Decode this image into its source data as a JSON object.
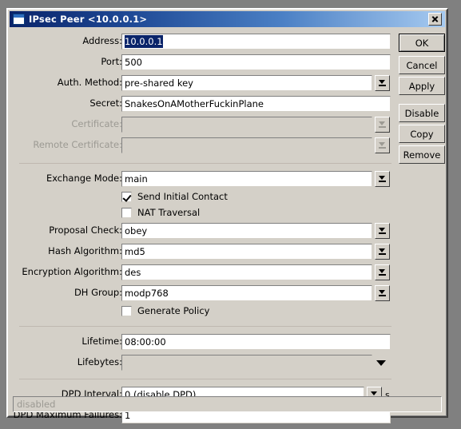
{
  "window": {
    "title": "IPsec Peer <10.0.0.1>",
    "icon": "window-icon",
    "close_icon": "close-icon"
  },
  "fields": {
    "address": {
      "label": "Address:",
      "value": "10.0.0.1",
      "selected": true
    },
    "port": {
      "label": "Port:",
      "value": "500"
    },
    "auth_method": {
      "label": "Auth. Method:",
      "value": "pre-shared key"
    },
    "secret": {
      "label": "Secret:",
      "value": "SnakesOnAMotherFuckinPlane"
    },
    "certificate": {
      "label": "Certificate:",
      "value": "",
      "disabled": true
    },
    "remote_certificate": {
      "label": "Remote Certificate:",
      "value": "",
      "disabled": true
    },
    "exchange_mode": {
      "label": "Exchange Mode:",
      "value": "main"
    },
    "proposal_check": {
      "label": "Proposal Check:",
      "value": "obey"
    },
    "hash_algorithm": {
      "label": "Hash Algorithm:",
      "value": "md5"
    },
    "encryption_algorithm": {
      "label": "Encryption Algorithm:",
      "value": "des"
    },
    "dh_group": {
      "label": "DH Group:",
      "value": "modp768"
    },
    "lifetime": {
      "label": "Lifetime:",
      "value": "08:00:00"
    },
    "lifebytes": {
      "label": "Lifebytes:",
      "value": "",
      "disabled": true
    },
    "dpd_interval": {
      "label": "DPD Interval:",
      "value": "0 (disable DPD)",
      "unit": "s"
    },
    "dpd_maximum_failures": {
      "label": "DPD Maximum Failures:",
      "value": "1"
    }
  },
  "checkboxes": {
    "send_initial_contact": {
      "label": "Send Initial Contact",
      "checked": true
    },
    "nat_traversal": {
      "label": "NAT Traversal",
      "checked": false
    },
    "generate_policy": {
      "label": "Generate Policy",
      "checked": false
    }
  },
  "buttons": {
    "ok": "OK",
    "cancel": "Cancel",
    "apply": "Apply",
    "disable": "Disable",
    "copy": "Copy",
    "remove": "Remove"
  },
  "statusbar": {
    "text": "disabled"
  },
  "colors": {
    "face": "#d4d0c8",
    "title_start": "#0a246a",
    "title_end": "#a6caf0",
    "selection": "#0a246a",
    "disabled_text": "#9c9a93",
    "desktop": "#808080"
  }
}
